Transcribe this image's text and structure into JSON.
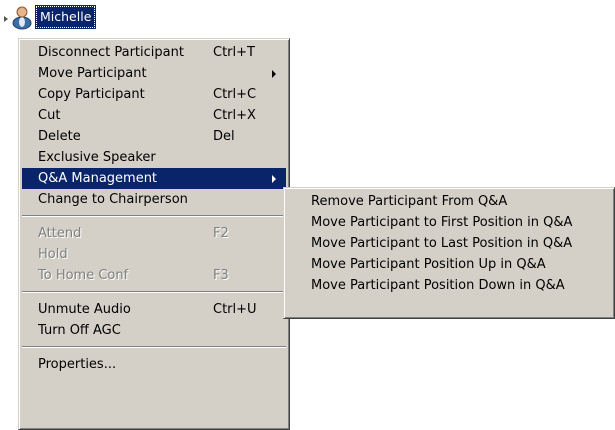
{
  "tree": {
    "node_label": "Michelle",
    "icon": "participant-person-icon"
  },
  "colors": {
    "menu_bg": "#d4d0c8",
    "selection": "#0a246a",
    "selection_text": "#ffffff",
    "disabled_text": "#808080"
  },
  "context_menu": {
    "groups": [
      [
        {
          "label": "Disconnect Participant",
          "shortcut": "Ctrl+T"
        },
        {
          "label": "Move Participant",
          "shortcut": "",
          "submenu": true
        },
        {
          "label": "Copy Participant",
          "shortcut": "Ctrl+C"
        },
        {
          "label": "Cut",
          "shortcut": "Ctrl+X"
        },
        {
          "label": "Delete",
          "shortcut": "Del"
        },
        {
          "label": "Exclusive Speaker",
          "shortcut": ""
        },
        {
          "label": "Q&A Management",
          "shortcut": "",
          "submenu": true,
          "selected": true
        },
        {
          "label": "Change to Chairperson",
          "shortcut": ""
        }
      ],
      [
        {
          "label": "Attend",
          "shortcut": "F2",
          "disabled": true
        },
        {
          "label": "Hold",
          "shortcut": "",
          "disabled": true
        },
        {
          "label": "To Home Conf",
          "shortcut": "F3",
          "disabled": true
        }
      ],
      [
        {
          "label": "Unmute Audio",
          "shortcut": "Ctrl+U"
        },
        {
          "label": "Turn Off AGC",
          "shortcut": ""
        }
      ],
      [
        {
          "label": "Properties...",
          "shortcut": ""
        }
      ]
    ]
  },
  "qa_submenu": {
    "items": [
      "Remove Participant From Q&A",
      "Move Participant to First Position in Q&A",
      "Move Participant to Last Position in Q&A",
      "Move Participant Position Up in Q&A",
      "Move Participant Position Down in Q&A"
    ]
  }
}
